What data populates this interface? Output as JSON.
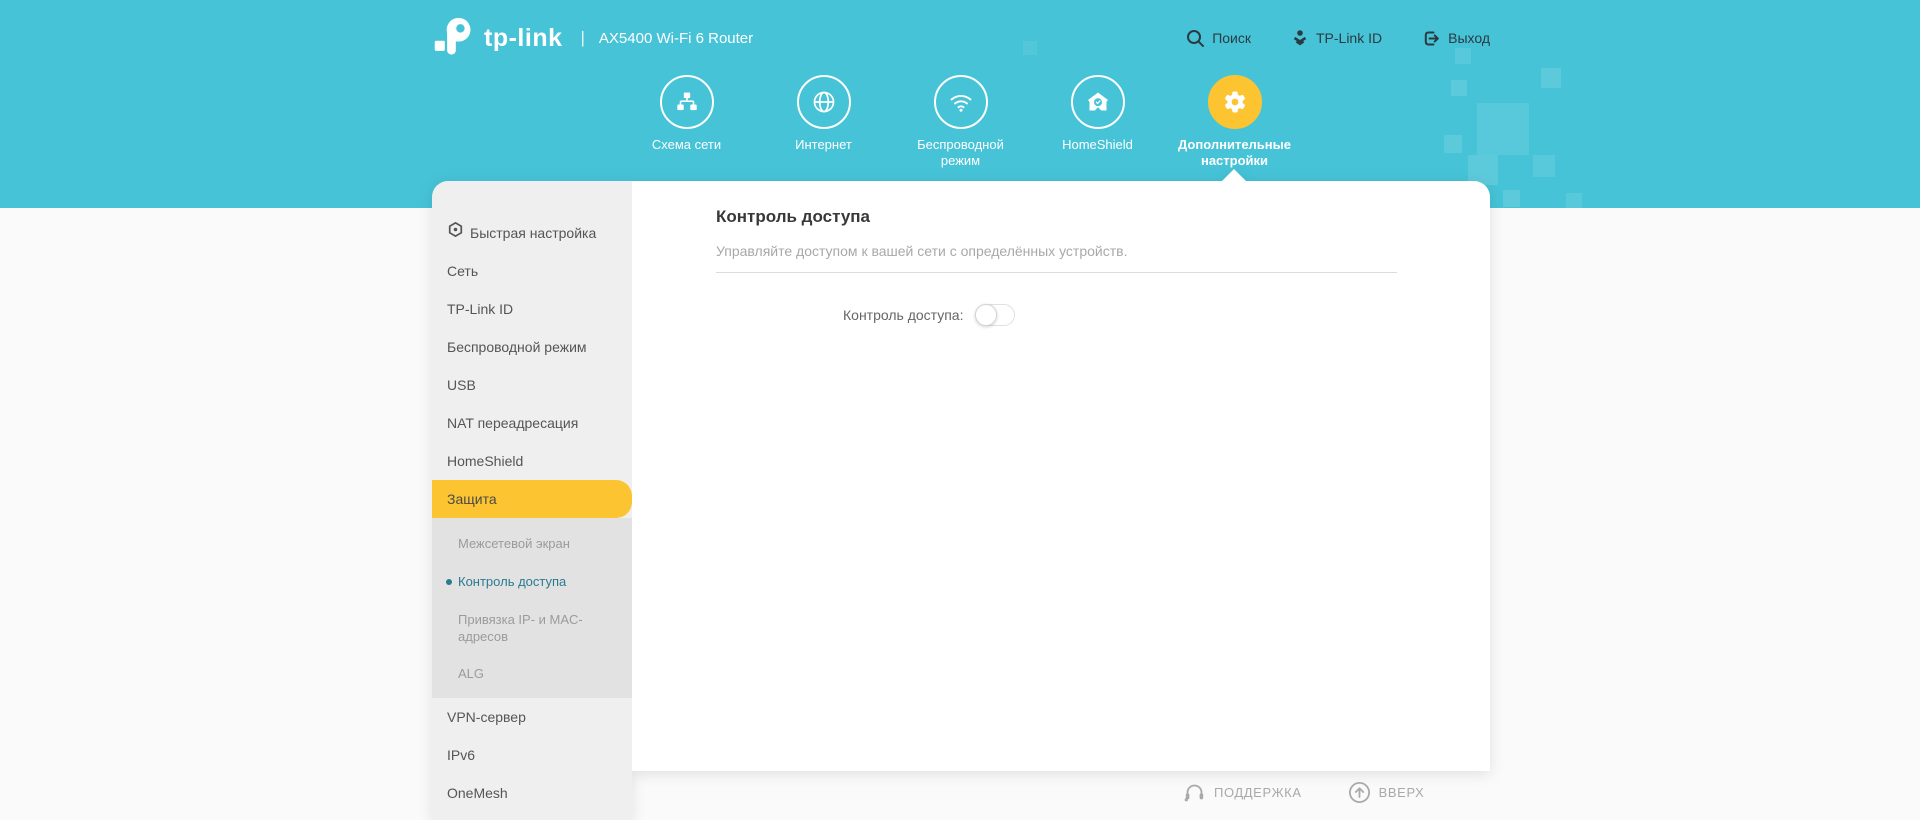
{
  "header": {
    "logo_text": "tp-link",
    "separator": "|",
    "product_title": "AX5400 Wi-Fi 6 Router",
    "actions": [
      {
        "label": "Поиск",
        "icon": "search-icon"
      },
      {
        "label": "TP-Link ID",
        "icon": "person-icon"
      },
      {
        "label": "Выход",
        "icon": "logout-icon"
      }
    ]
  },
  "nav": {
    "items": [
      {
        "label": "Схема сети",
        "icon": "network-map-icon",
        "active": false
      },
      {
        "label": "Интернет",
        "icon": "globe-icon",
        "active": false
      },
      {
        "label": "Беспроводной режим",
        "icon": "wifi-icon",
        "active": false
      },
      {
        "label": "HomeShield",
        "icon": "home-shield-icon",
        "active": false
      },
      {
        "label": "Дополнительные настройки",
        "icon": "gear-icon",
        "active": true
      }
    ]
  },
  "sidebar": {
    "items": [
      {
        "label": "Быстрая настройка",
        "icon": "gear-outline-icon"
      },
      {
        "label": "Сеть"
      },
      {
        "label": "TP-Link ID"
      },
      {
        "label": "Беспроводной режим"
      },
      {
        "label": "USB"
      },
      {
        "label": "NAT переадресация"
      },
      {
        "label": "HomeShield"
      },
      {
        "label": "Защита",
        "active": true
      }
    ],
    "security_submenu": [
      {
        "label": "Межсетевой экран",
        "selected": false
      },
      {
        "label": "Контроль доступа",
        "selected": true
      },
      {
        "label": "Привязка IP- и MAC-адресов",
        "selected": false
      },
      {
        "label": "ALG",
        "selected": false
      }
    ],
    "items_bottom": [
      {
        "label": "VPN-сервер"
      },
      {
        "label": "IPv6"
      },
      {
        "label": "OneMesh"
      }
    ]
  },
  "content": {
    "title": "Контроль доступа",
    "description": "Управляйте доступом к вашей сети с определённых устройств.",
    "toggle_label": "Контроль доступа:",
    "toggle_on": false
  },
  "footer": {
    "support_label": "ПОДДЕРЖКА",
    "back_to_top_label": "ВВЕРХ"
  },
  "colors": {
    "header_teal": "#46c3d7",
    "accent_yellow": "#fcc430",
    "submenu_selected_text": "#2a7b90",
    "sidebar_bg": "#efefef",
    "submenu_bg": "#e2e2e2"
  }
}
